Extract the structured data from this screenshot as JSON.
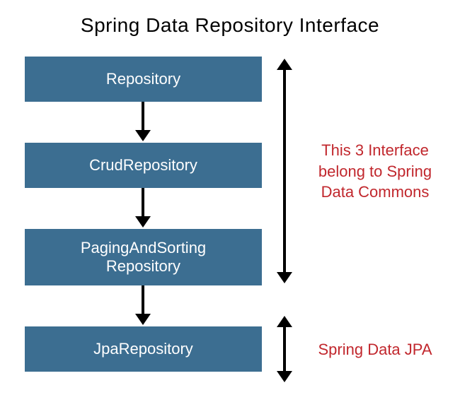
{
  "title": "Spring Data Repository Interface",
  "boxes": {
    "repository": "Repository",
    "crud": "CrudRepository",
    "paging_line1": "PagingAndSorting",
    "paging_line2": "Repository",
    "jpa": "JpaRepository"
  },
  "annotations": {
    "commons": "This 3 Interface belong to Spring Data Commons",
    "jpa": "Spring Data JPA"
  },
  "colors": {
    "box_bg": "#3c6e91",
    "box_text": "#ffffff",
    "annotation_text": "#c1272d",
    "arrow": "#000000"
  }
}
